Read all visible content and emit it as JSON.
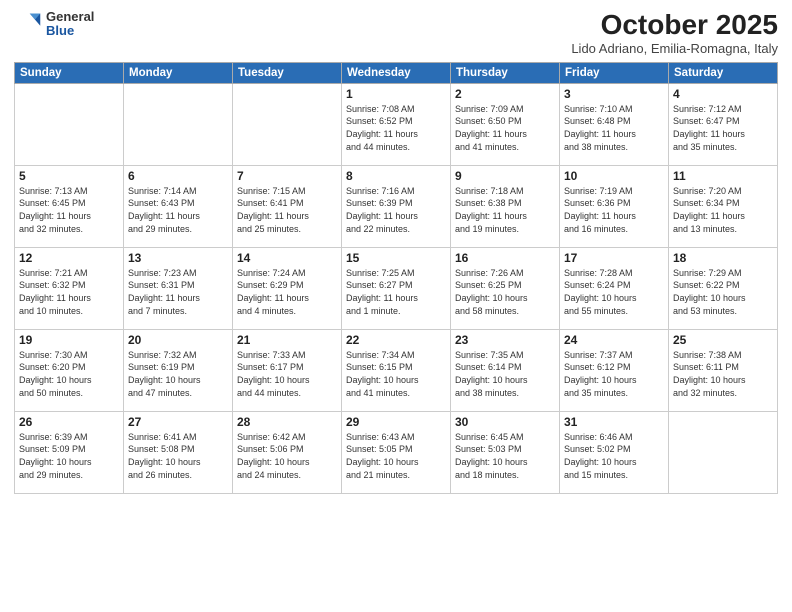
{
  "header": {
    "logo_general": "General",
    "logo_blue": "Blue",
    "month_title": "October 2025",
    "location": "Lido Adriano, Emilia-Romagna, Italy"
  },
  "weekdays": [
    "Sunday",
    "Monday",
    "Tuesday",
    "Wednesday",
    "Thursday",
    "Friday",
    "Saturday"
  ],
  "weeks": [
    [
      {
        "day": "",
        "info": ""
      },
      {
        "day": "",
        "info": ""
      },
      {
        "day": "",
        "info": ""
      },
      {
        "day": "1",
        "info": "Sunrise: 7:08 AM\nSunset: 6:52 PM\nDaylight: 11 hours\nand 44 minutes."
      },
      {
        "day": "2",
        "info": "Sunrise: 7:09 AM\nSunset: 6:50 PM\nDaylight: 11 hours\nand 41 minutes."
      },
      {
        "day": "3",
        "info": "Sunrise: 7:10 AM\nSunset: 6:48 PM\nDaylight: 11 hours\nand 38 minutes."
      },
      {
        "day": "4",
        "info": "Sunrise: 7:12 AM\nSunset: 6:47 PM\nDaylight: 11 hours\nand 35 minutes."
      }
    ],
    [
      {
        "day": "5",
        "info": "Sunrise: 7:13 AM\nSunset: 6:45 PM\nDaylight: 11 hours\nand 32 minutes."
      },
      {
        "day": "6",
        "info": "Sunrise: 7:14 AM\nSunset: 6:43 PM\nDaylight: 11 hours\nand 29 minutes."
      },
      {
        "day": "7",
        "info": "Sunrise: 7:15 AM\nSunset: 6:41 PM\nDaylight: 11 hours\nand 25 minutes."
      },
      {
        "day": "8",
        "info": "Sunrise: 7:16 AM\nSunset: 6:39 PM\nDaylight: 11 hours\nand 22 minutes."
      },
      {
        "day": "9",
        "info": "Sunrise: 7:18 AM\nSunset: 6:38 PM\nDaylight: 11 hours\nand 19 minutes."
      },
      {
        "day": "10",
        "info": "Sunrise: 7:19 AM\nSunset: 6:36 PM\nDaylight: 11 hours\nand 16 minutes."
      },
      {
        "day": "11",
        "info": "Sunrise: 7:20 AM\nSunset: 6:34 PM\nDaylight: 11 hours\nand 13 minutes."
      }
    ],
    [
      {
        "day": "12",
        "info": "Sunrise: 7:21 AM\nSunset: 6:32 PM\nDaylight: 11 hours\nand 10 minutes."
      },
      {
        "day": "13",
        "info": "Sunrise: 7:23 AM\nSunset: 6:31 PM\nDaylight: 11 hours\nand 7 minutes."
      },
      {
        "day": "14",
        "info": "Sunrise: 7:24 AM\nSunset: 6:29 PM\nDaylight: 11 hours\nand 4 minutes."
      },
      {
        "day": "15",
        "info": "Sunrise: 7:25 AM\nSunset: 6:27 PM\nDaylight: 11 hours\nand 1 minute."
      },
      {
        "day": "16",
        "info": "Sunrise: 7:26 AM\nSunset: 6:25 PM\nDaylight: 10 hours\nand 58 minutes."
      },
      {
        "day": "17",
        "info": "Sunrise: 7:28 AM\nSunset: 6:24 PM\nDaylight: 10 hours\nand 55 minutes."
      },
      {
        "day": "18",
        "info": "Sunrise: 7:29 AM\nSunset: 6:22 PM\nDaylight: 10 hours\nand 53 minutes."
      }
    ],
    [
      {
        "day": "19",
        "info": "Sunrise: 7:30 AM\nSunset: 6:20 PM\nDaylight: 10 hours\nand 50 minutes."
      },
      {
        "day": "20",
        "info": "Sunrise: 7:32 AM\nSunset: 6:19 PM\nDaylight: 10 hours\nand 47 minutes."
      },
      {
        "day": "21",
        "info": "Sunrise: 7:33 AM\nSunset: 6:17 PM\nDaylight: 10 hours\nand 44 minutes."
      },
      {
        "day": "22",
        "info": "Sunrise: 7:34 AM\nSunset: 6:15 PM\nDaylight: 10 hours\nand 41 minutes."
      },
      {
        "day": "23",
        "info": "Sunrise: 7:35 AM\nSunset: 6:14 PM\nDaylight: 10 hours\nand 38 minutes."
      },
      {
        "day": "24",
        "info": "Sunrise: 7:37 AM\nSunset: 6:12 PM\nDaylight: 10 hours\nand 35 minutes."
      },
      {
        "day": "25",
        "info": "Sunrise: 7:38 AM\nSunset: 6:11 PM\nDaylight: 10 hours\nand 32 minutes."
      }
    ],
    [
      {
        "day": "26",
        "info": "Sunrise: 6:39 AM\nSunset: 5:09 PM\nDaylight: 10 hours\nand 29 minutes."
      },
      {
        "day": "27",
        "info": "Sunrise: 6:41 AM\nSunset: 5:08 PM\nDaylight: 10 hours\nand 26 minutes."
      },
      {
        "day": "28",
        "info": "Sunrise: 6:42 AM\nSunset: 5:06 PM\nDaylight: 10 hours\nand 24 minutes."
      },
      {
        "day": "29",
        "info": "Sunrise: 6:43 AM\nSunset: 5:05 PM\nDaylight: 10 hours\nand 21 minutes."
      },
      {
        "day": "30",
        "info": "Sunrise: 6:45 AM\nSunset: 5:03 PM\nDaylight: 10 hours\nand 18 minutes."
      },
      {
        "day": "31",
        "info": "Sunrise: 6:46 AM\nSunset: 5:02 PM\nDaylight: 10 hours\nand 15 minutes."
      },
      {
        "day": "",
        "info": ""
      }
    ]
  ]
}
